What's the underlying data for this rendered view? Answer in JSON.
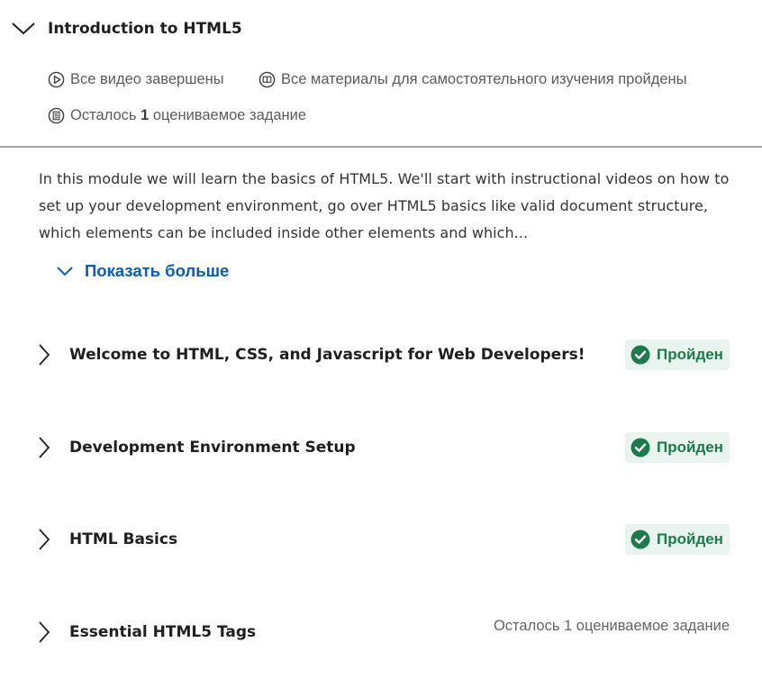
{
  "module": {
    "title": "Introduction to HTML5",
    "meta": {
      "videos_done": "Все видео завершены",
      "reading_done": "Все материалы для самостоятельного изучения пройдены",
      "remaining_prefix": "Осталось",
      "remaining_count": "1",
      "remaining_suffix": "оцениваемое задание"
    },
    "description": "In this module we will learn the basics of HTML5. We'll start with instructional videos on how to set up your development environment, go over HTML5 basics like valid document structure, which elements can be included inside other elements and which...",
    "show_more_label": "Показать больше"
  },
  "lessons": [
    {
      "title": "Welcome to HTML, CSS, and Javascript for Web Developers!",
      "status": "Пройден"
    },
    {
      "title": "Development Environment Setup",
      "status": "Пройден"
    },
    {
      "title": "HTML Basics",
      "status": "Пройден"
    },
    {
      "title": "Essential HTML5 Tags",
      "remaining": "Осталось 1 оцениваемое задание"
    }
  ],
  "colors": {
    "link": "#0b5bb8",
    "success_text": "#1e7a4a",
    "success_bg": "#e9f4ee",
    "divider": "#a8a8a8"
  },
  "icons": {
    "collapse": "chevron-down-icon",
    "video": "play-circle-icon",
    "reading": "book-circle-icon",
    "assignment": "assignment-circle-icon",
    "expand_lesson": "chevron-right-icon",
    "done": "check-circle-icon"
  }
}
